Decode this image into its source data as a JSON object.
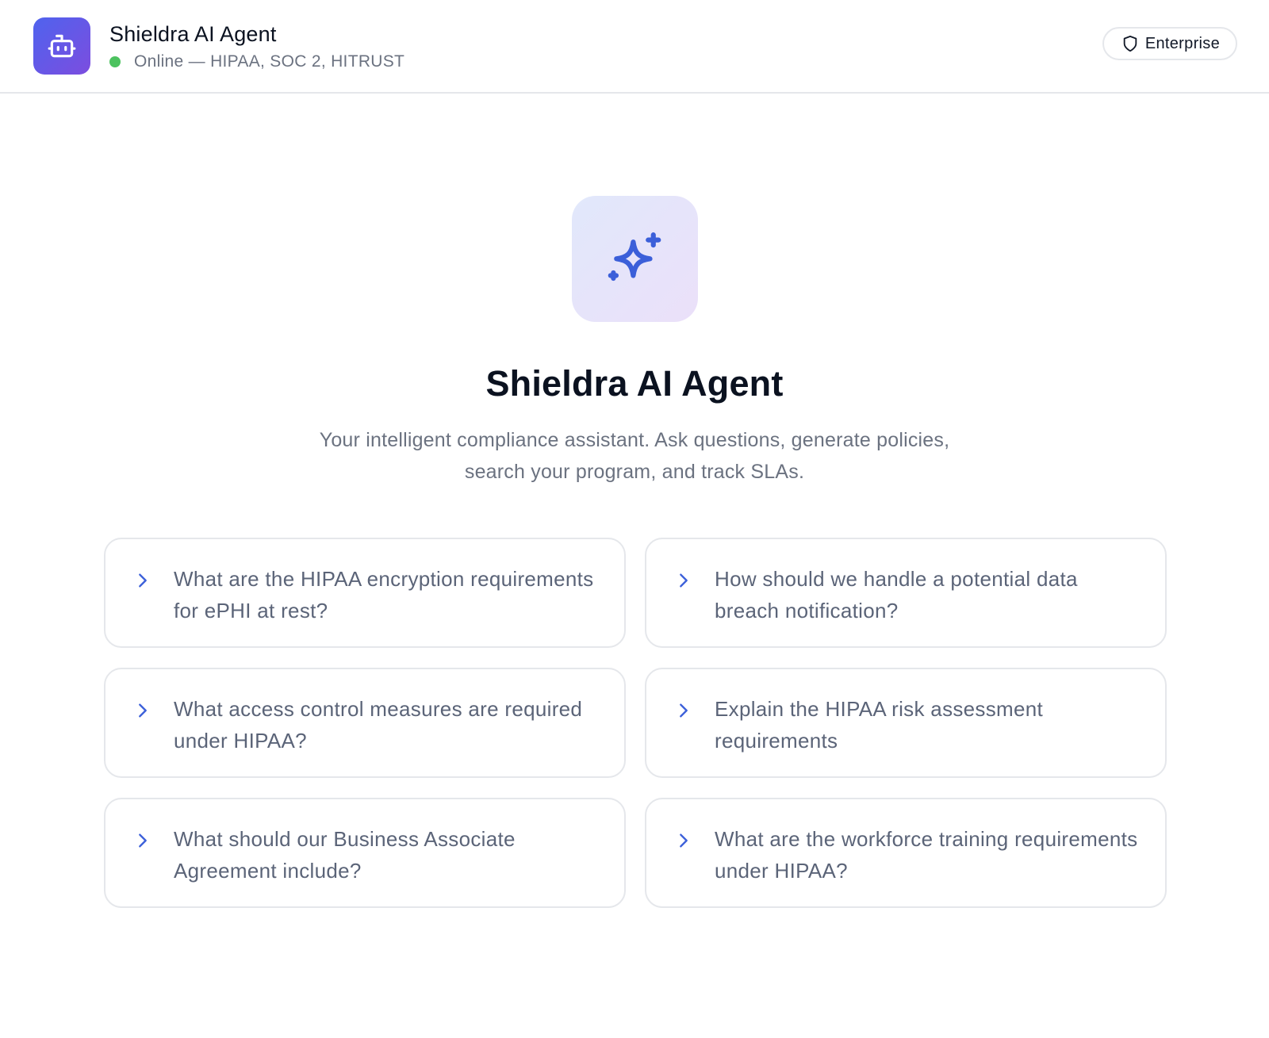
{
  "header": {
    "app_title": "Shieldra AI Agent",
    "status_text": "Online — HIPAA, SOC 2, HITRUST",
    "status_color": "#4cc25f",
    "logo_icon": "robot-icon",
    "plan_badge": {
      "icon": "shield-icon",
      "label": "Enterprise"
    }
  },
  "hero": {
    "icon": "sparkles-icon",
    "title": "Shieldra AI Agent",
    "subtitle": "Your intelligent compliance assistant. Ask questions, generate policies, search your program, and track SLAs."
  },
  "suggestions": [
    {
      "text": "What are the HIPAA encryption requirements for ePHI at rest?"
    },
    {
      "text": "How should we handle a potential data breach notification?"
    },
    {
      "text": "What access control measures are required under HIPAA?"
    },
    {
      "text": "Explain the HIPAA risk assessment requirements"
    },
    {
      "text": "What should our Business Associate Agreement include?"
    },
    {
      "text": "What are the workforce training requirements under HIPAA?"
    }
  ],
  "colors": {
    "accent": "#3b5fd9",
    "logo_gradient_start": "#4f63ee",
    "logo_gradient_end": "#7c4ddf",
    "muted_text": "#6b7280",
    "border": "#e5e7eb"
  }
}
